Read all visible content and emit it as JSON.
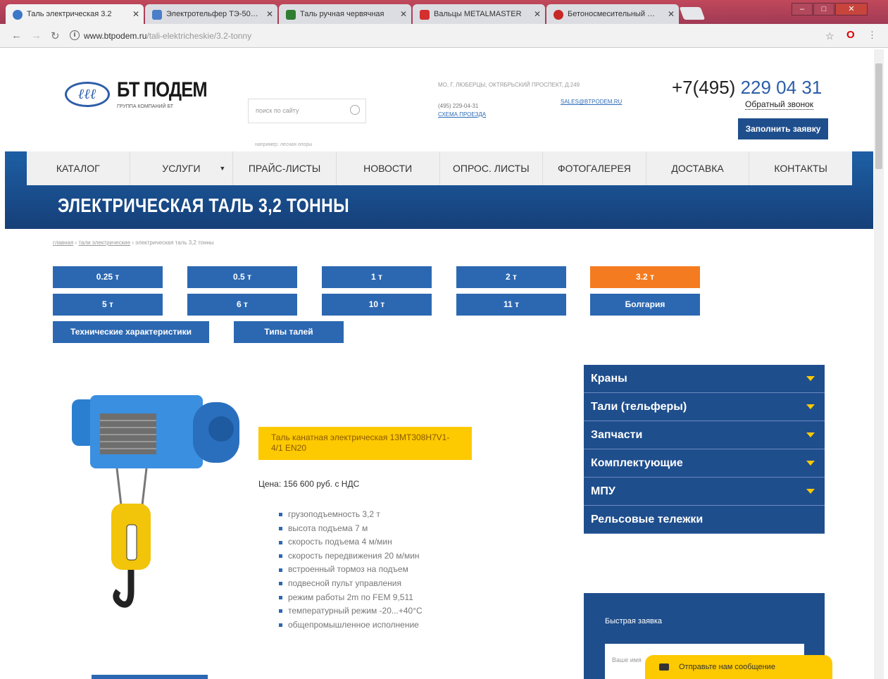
{
  "browser": {
    "tabs": [
      {
        "label": "Таль электрическая 3.2",
        "icon_color": "#3c78c8"
      },
      {
        "label": "Электротельфер ТЭ-50…",
        "icon_color": "#4a7ec9"
      },
      {
        "label": "Таль ручная червячная",
        "icon_color": "#2e7d32"
      },
      {
        "label": "Вальцы METALMASTER",
        "icon_color": "#d32f2f"
      },
      {
        "label": "Бетоносмесительный …",
        "icon_color": "#c62828"
      }
    ],
    "url_domain": "www.btpodem.ru",
    "url_path": "/tali-elektricheskie/3.2-tonny",
    "accent": "#a13a55"
  },
  "header": {
    "logo_text": "БТ ПОДЕМ",
    "logo_sub": "ГРУППА КОМПАНИЙ БТ",
    "search_placeholder": "поиск по сайту",
    "search_hint": "например: лесная опоры",
    "address": "МО, Г. ЛЮБЕРЦЫ, ОКТЯБРЬСКИЙ ПРОСПЕКТ, Д.249",
    "phone_small": "(495) 229-04-31",
    "route_link": "СХЕМА ПРОЕЗДА",
    "email": "SALES@BTPODEM.RU",
    "phone_code": "+7(495)",
    "phone_number": "229 04 31",
    "callback": "Обратный звонок",
    "order_button": "Заполнить заявку"
  },
  "menu": {
    "items": [
      "КАТАЛОГ",
      "УСЛУГИ",
      "ПРАЙС-ЛИСТЫ",
      "НОВОСТИ",
      "ОПРОС. ЛИСТЫ",
      "ФОТОГАЛЕРЕЯ",
      "ДОСТАВКА",
      "КОНТАКТЫ"
    ]
  },
  "page": {
    "title": "ЭЛЕКТРИЧЕСКАЯ ТАЛЬ 3,2 ТОННЫ",
    "breadcrumb_home": "главная",
    "breadcrumb_cat": "тали электрические",
    "breadcrumb_current": "электрическая таль 3,2 тонны"
  },
  "tonnage": {
    "row1": [
      "0.25 т",
      "0.5 т",
      "1 т",
      "2 т",
      "3.2 т"
    ],
    "row2": [
      "5 т",
      "6 т",
      "10 т",
      "11 т",
      "Болгария"
    ],
    "row3": [
      "Технические характеристики",
      "Типы талей"
    ],
    "active": "3.2 т"
  },
  "product": {
    "name": "Таль канатная электрическая 13МТ308Н7V1-4/1 EN20",
    "price": "Цена: 156 600 руб. с НДС",
    "specs": [
      "грузоподъемность 3,2 т",
      "высота подъема 7 м",
      "скорость подъема 4 м/мин",
      "скорость передвижения 20 м/мин",
      "встроенный тормоз на подъем",
      "подвесной пульт управления",
      "режим работы 2m по FEM 9,511",
      "температурный режим -20...+40°С",
      "общепромышленное исполнение"
    ]
  },
  "sidebar": {
    "categories": [
      "Краны",
      "Тали (тельферы)",
      "Запчасти",
      "Комплектующие",
      "МПУ",
      "Рельсовые тележки"
    ],
    "quick_title": "Быстрая заявка",
    "quick_placeholder": "Ваше имя",
    "chat_label": "Отправьте нам сообщение"
  }
}
